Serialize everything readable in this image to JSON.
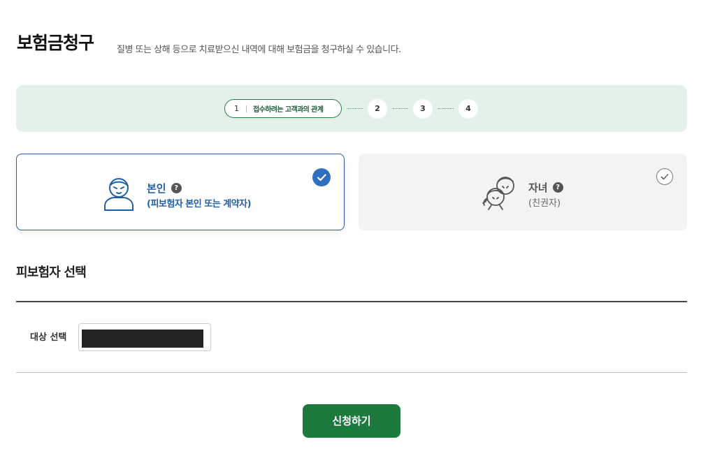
{
  "header": {
    "title": "보험금청구",
    "description": "질병 또는 상해 등으로 치료받으신 내역에 대해 보험금을 청구하실 수 있습니다."
  },
  "stepper": {
    "active_step": {
      "number": "1",
      "label": "접수하려는 고객과의 관계"
    },
    "steps": [
      "2",
      "3",
      "4"
    ]
  },
  "relationship_options": [
    {
      "title": "본인",
      "subtitle": "(피보험자 본인 또는 계약자)",
      "selected": true,
      "icon": "person-icon"
    },
    {
      "title": "자녀",
      "subtitle": "(친권자)",
      "selected": false,
      "icon": "children-icon"
    }
  ],
  "help_glyph": "?",
  "insured_section": {
    "title": "피보험자 선택",
    "field_label": "대상 선택",
    "field_value_redacted": true
  },
  "submit": {
    "label": "신청하기"
  },
  "colors": {
    "brand_green": "#1c7a3f",
    "stepper_bg": "#e4f1e8",
    "selected_blue": "#1e5fa8"
  }
}
